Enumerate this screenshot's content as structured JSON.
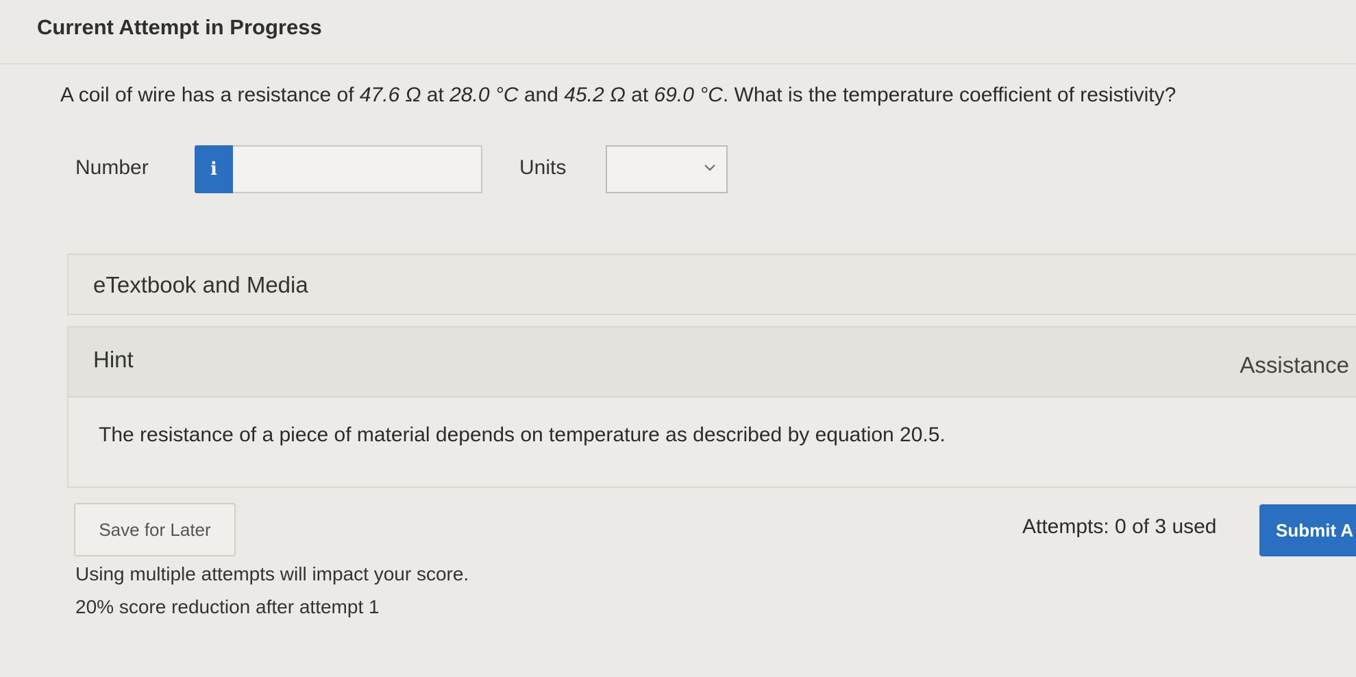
{
  "header": {
    "title": "Current Attempt in Progress"
  },
  "question": {
    "text_1": "A coil of wire has a resistance of ",
    "r1": "47.6 Ω",
    "text_2": " at ",
    "t1": "28.0 °C",
    "text_3": " and ",
    "r2": "45.2 Ω",
    "text_4": " at ",
    "t2": "69.0 °C",
    "text_5": ". What is the temperature coefficient of resistivity?"
  },
  "answer": {
    "number_label": "Number",
    "info_icon": "i",
    "number_value": "",
    "units_label": "Units",
    "units_selected": ""
  },
  "resources": {
    "etextbook_label": "eTextbook and Media"
  },
  "hint": {
    "label": "Hint",
    "assistance_label": "Assistance",
    "text": "The resistance of a piece of material depends on temperature as described by equation 20.5."
  },
  "footer": {
    "save_label": "Save for Later",
    "attempts_text": "Attempts: 0 of 3 used",
    "submit_label": "Submit A",
    "note_1": "Using multiple attempts will impact your score.",
    "note_2": "20% score reduction after attempt 1"
  },
  "colors": {
    "accent": "#2a6fc0",
    "background": "#ebeae6"
  },
  "icons": {
    "info": "info-icon",
    "dropdown": "chevron-down-icon"
  }
}
